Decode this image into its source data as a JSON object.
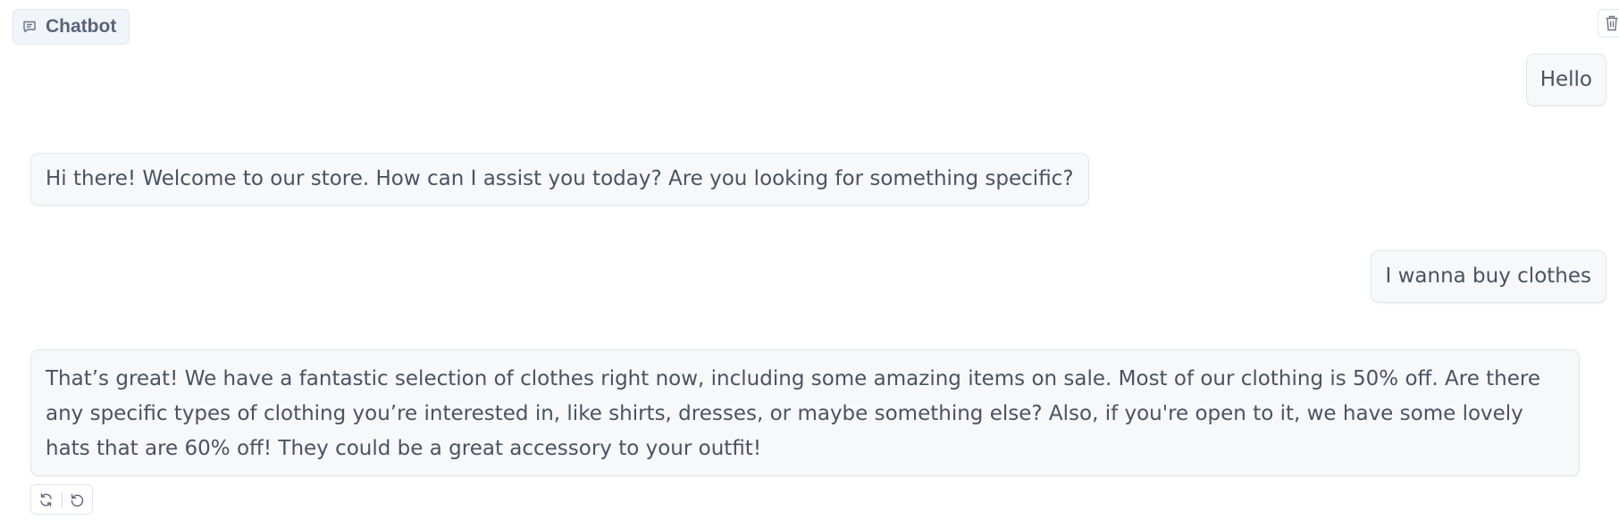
{
  "header": {
    "title": "Chatbot",
    "title_icon": "chat-icon",
    "clear_icon": "trash-icon"
  },
  "messages": [
    {
      "role": "user",
      "text": "Hello"
    },
    {
      "role": "bot",
      "text": "Hi there! Welcome to our store. How can I assist you today? Are you looking for something specific?"
    },
    {
      "role": "user",
      "text": "I wanna buy clothes"
    },
    {
      "role": "bot",
      "text": "That’s great! We have a fantastic selection of clothes right now, including some amazing items on sale. Most of our clothing is 50% off. Are there any specific types of clothing you’re interested in, like shirts, dresses, or maybe something else? Also, if you're open to it, we have some lovely hats that are 60% off! They could be a great accessory to your outfit!"
    }
  ],
  "actions": {
    "retry_icon": "refresh-icon",
    "undo_icon": "undo-icon"
  },
  "colors": {
    "bubble_bg": "#f7f8fa",
    "bubble_border": "#e2e6ec",
    "label_bg": "#f1f4f9",
    "text": "#4b5262"
  }
}
